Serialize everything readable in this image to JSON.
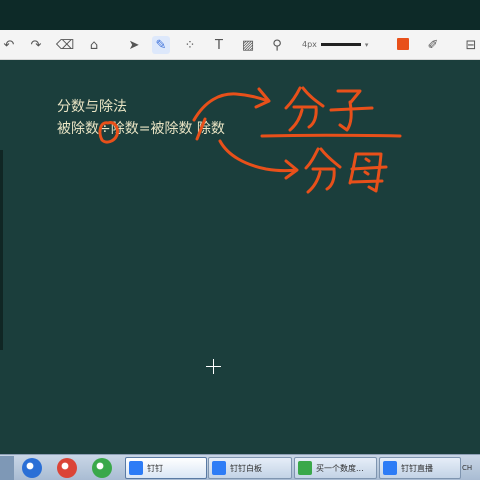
{
  "toolbar": {
    "tools": [
      {
        "name": "undo-icon",
        "glyph": "↶"
      },
      {
        "name": "redo-icon",
        "glyph": "↷"
      },
      {
        "name": "eraser-icon",
        "glyph": "⌫"
      },
      {
        "name": "clear-icon",
        "glyph": "⌂"
      },
      {
        "name": "select-pointer-icon",
        "glyph": "➤"
      },
      {
        "name": "pen-icon",
        "glyph": "✎",
        "active": true
      },
      {
        "name": "shapes-icon",
        "glyph": "⁘"
      },
      {
        "name": "text-tool-icon",
        "glyph": "T"
      },
      {
        "name": "image-icon",
        "glyph": "▨"
      },
      {
        "name": "brush-icon",
        "glyph": "⚲"
      },
      {
        "name": "edit-icon",
        "glyph": "✐"
      },
      {
        "name": "save-icon",
        "glyph": "⊟"
      }
    ],
    "pen_size": "4px",
    "pen_color": "#e8501a"
  },
  "board": {
    "title": "分数与除法",
    "equation": "被除数÷除数=被除数 除数",
    "ink_color": "#e8501a",
    "background": "#1b3e3c",
    "annotations": {
      "numerator": "分子",
      "denominator": "分母"
    }
  },
  "taskbar": {
    "quicklaunch": [
      {
        "name": "ie-icon",
        "color": "#2a6fd6"
      },
      {
        "name": "chrome-icon",
        "color": "#db4437"
      },
      {
        "name": "media-player-icon",
        "color": "#3aa84a"
      }
    ],
    "tasks": [
      {
        "label": "钉钉",
        "icon_color": "#2d7cf6",
        "active": true
      },
      {
        "label": "钉钉白板",
        "icon_color": "#2d7cf6",
        "active": false
      },
      {
        "label": "买一个数度...",
        "icon_color": "#3aa84a",
        "active": false
      },
      {
        "label": "钉钉直播",
        "icon_color": "#2d7cf6",
        "active": false
      }
    ],
    "tray_text": "CH"
  }
}
